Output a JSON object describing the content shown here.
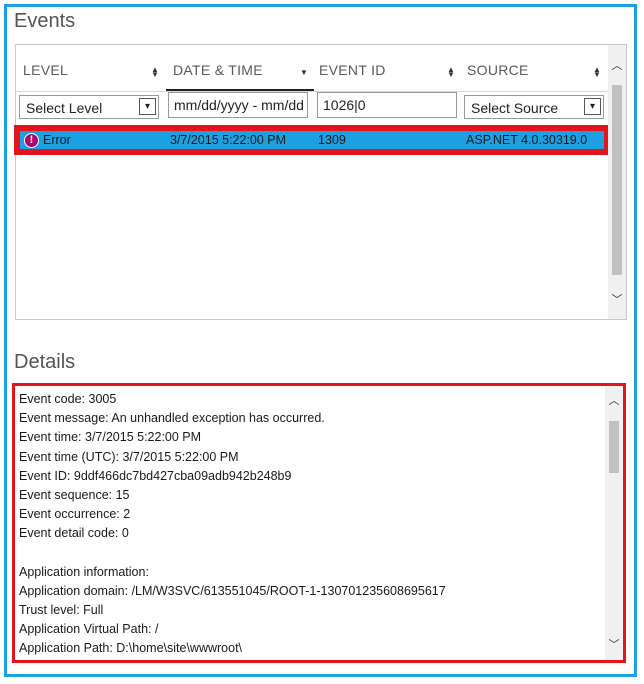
{
  "events": {
    "title": "Events",
    "columns": [
      {
        "label": "LEVEL"
      },
      {
        "label": "DATE & TIME"
      },
      {
        "label": "EVENT ID"
      },
      {
        "label": "SOURCE"
      }
    ],
    "filters": {
      "level_select": "Select Level",
      "date_input": "mm/dd/yyyy - mm/dd",
      "event_id_input": "1026|0",
      "source_select": "Select Source"
    },
    "rows": [
      {
        "level": "Error",
        "datetime": "3/7/2015 5:22:00 PM",
        "event_id": "1309",
        "source": "ASP.NET 4.0.30319.0"
      }
    ]
  },
  "details": {
    "title": "Details",
    "lines": [
      "Event code: 3005",
      "Event message: An unhandled exception has occurred.",
      "Event time: 3/7/2015 5:22:00 PM",
      "Event time (UTC): 3/7/2015 5:22:00 PM",
      "Event ID: 9ddf466dc7bd427cba09adb942b248b9",
      "Event sequence: 15",
      "Event occurrence: 2",
      "Event detail code: 0",
      "",
      "Application information:",
      "Application domain: /LM/W3SVC/613551045/ROOT-1-130701235608695617",
      "Trust level: Full",
      "Application Virtual Path: /",
      "Application Path: D:\\home\\site\\wwwroot\\"
    ]
  },
  "colors": {
    "accent_blue": "#1ba1e2",
    "highlight_red": "#e3141e",
    "error_icon": "#b0006a"
  }
}
